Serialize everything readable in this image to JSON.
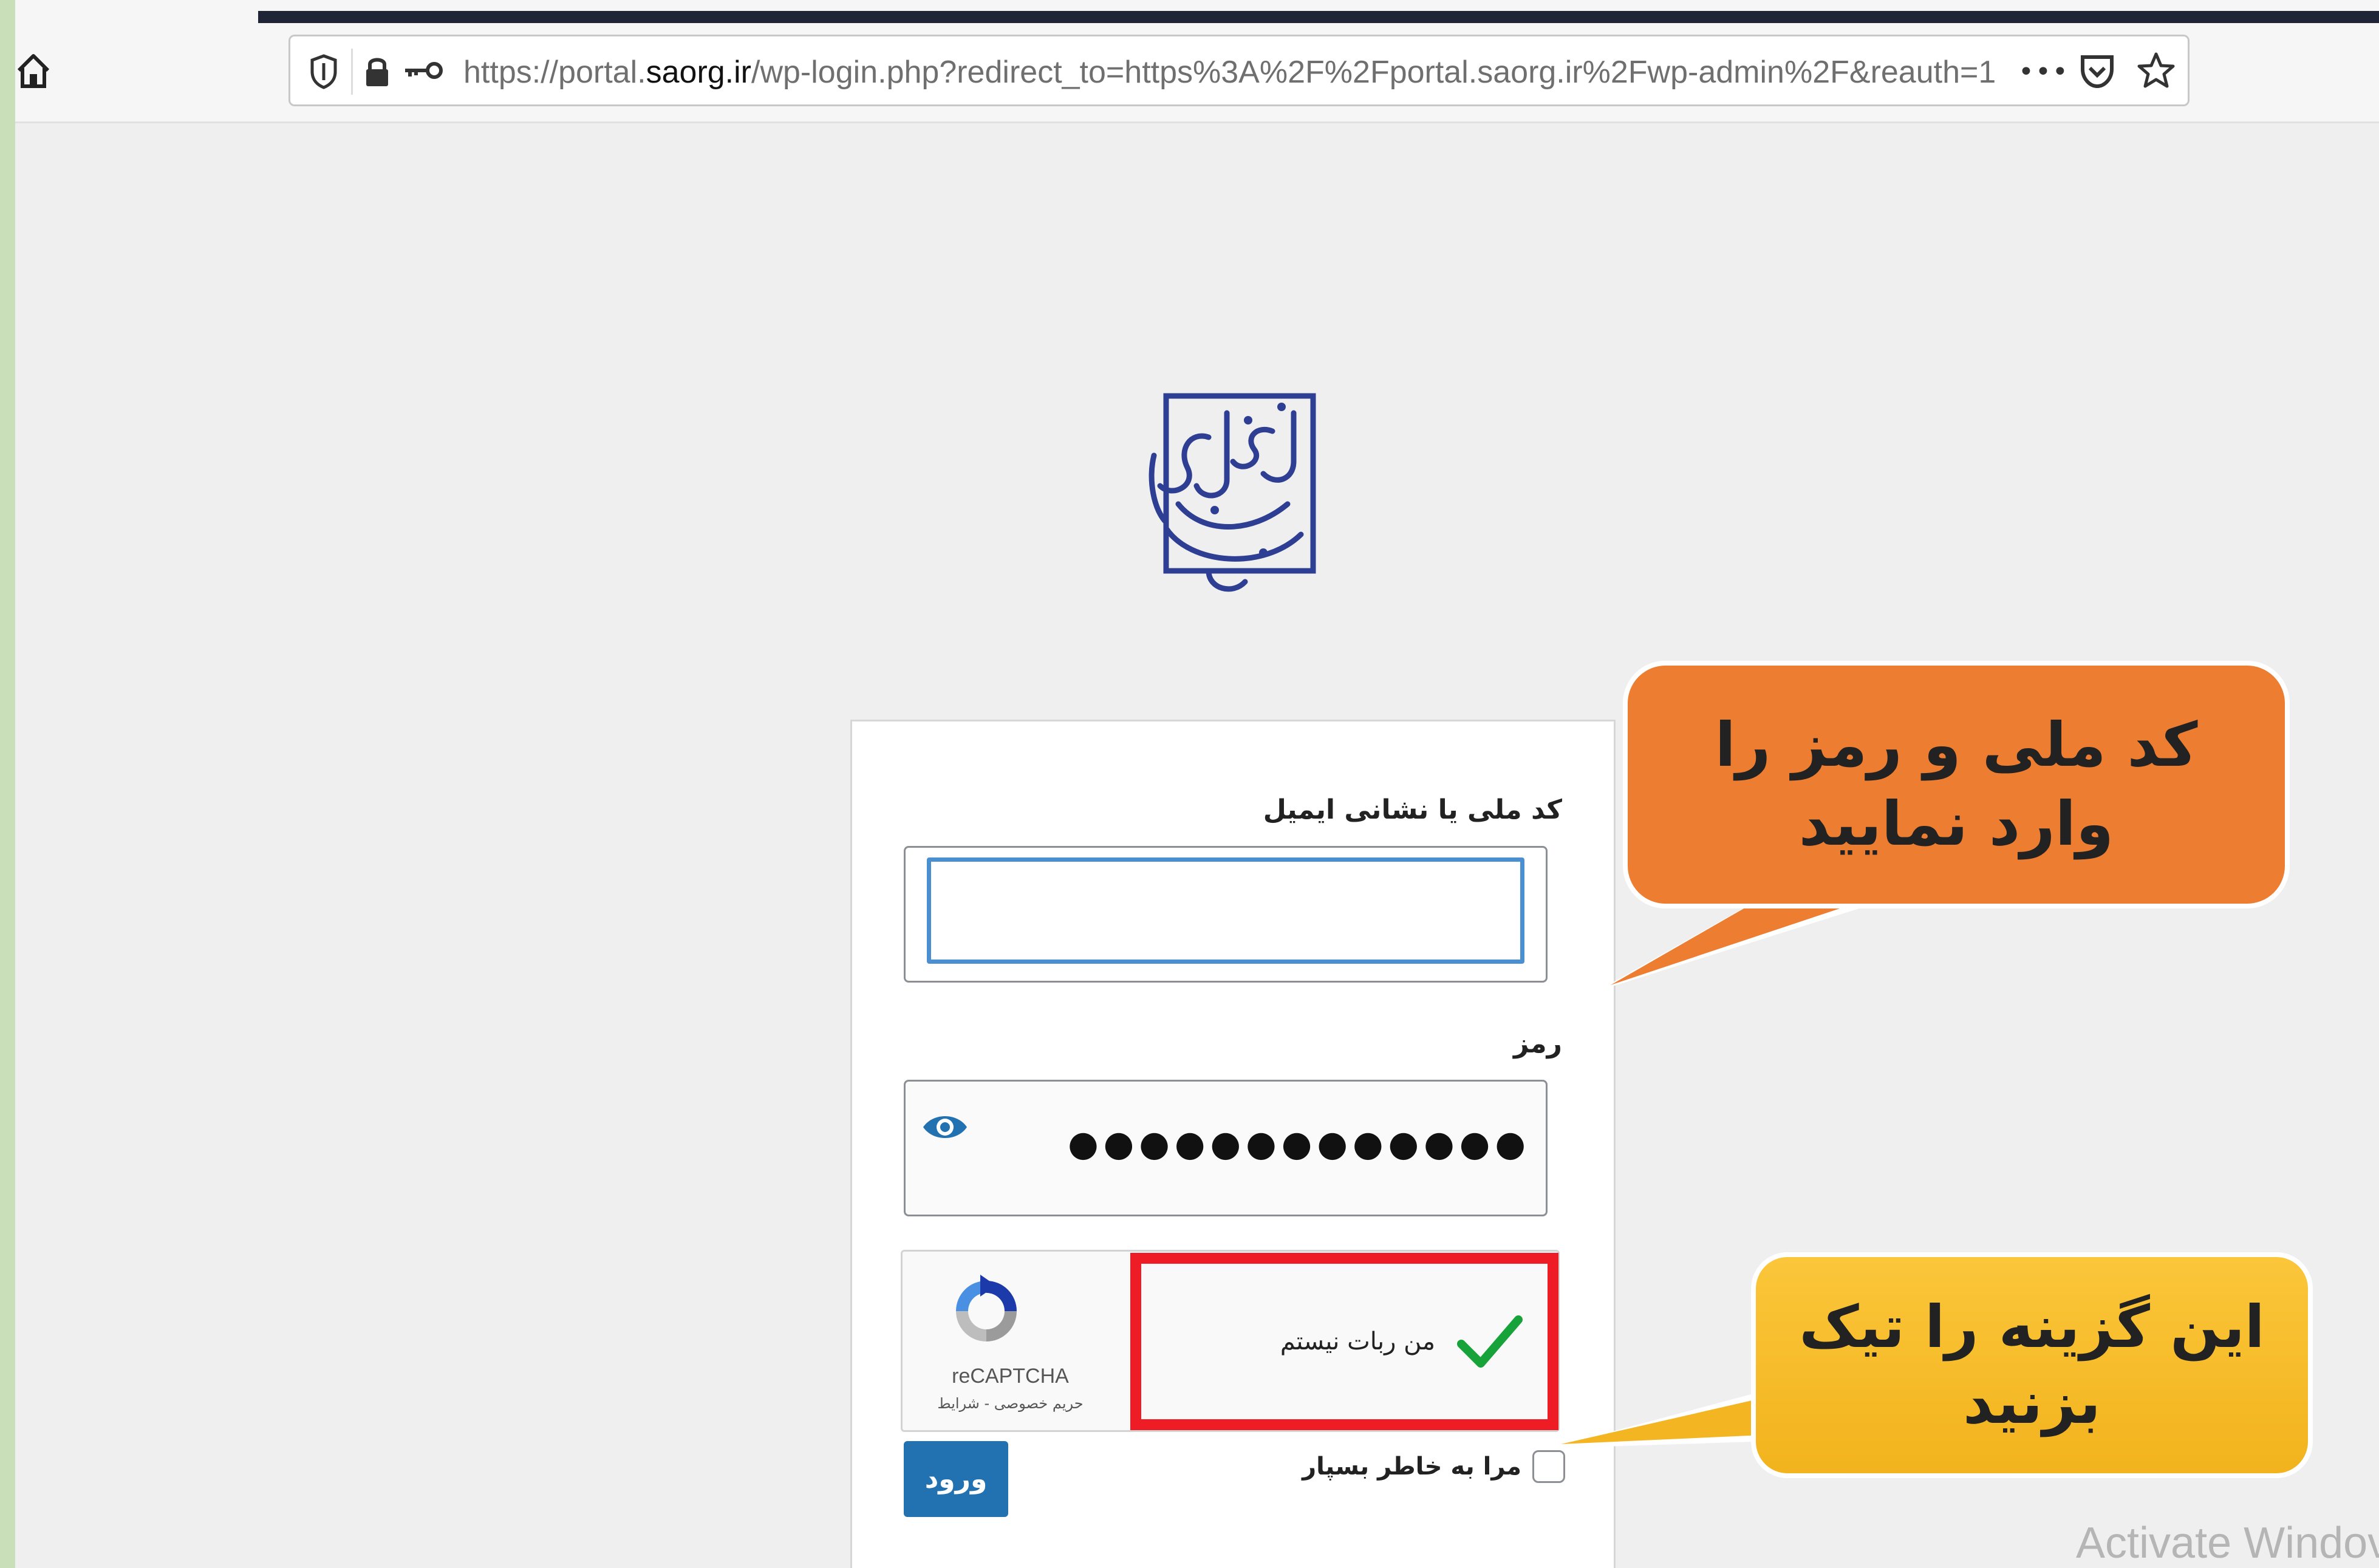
{
  "browser": {
    "url_prefix": "https://portal.",
    "url_domain": "saorg.ir",
    "url_suffix": "/wp-login.php?redirect_to=https%3A%2F%2Fportal.saorg.ir%2Fwp-admin%2F&reauth=1",
    "overflow_menu": "•••",
    "icons": [
      "home-icon",
      "shield-icon",
      "lock-icon",
      "key-icon",
      "pocket-icon",
      "star-icon"
    ]
  },
  "login": {
    "username_label": "کد ملی یا نشانی ایمیل",
    "username_value": "",
    "password_label": "رمز",
    "password_mask": "●●●●●●●●●●●●●",
    "recaptcha_label": "من ربات نیستم",
    "recaptcha_brand": "reCAPTCHA",
    "recaptcha_links": "حریم خصوصی - شرایط",
    "recaptcha_checked": true,
    "remember_label": "مرا به خاطر بسپار",
    "remember_checked": false,
    "submit_label": "ورود"
  },
  "annotations": {
    "callout_credentials_line1": "کد ملی و رمز را",
    "callout_credentials_line2": "وارد نمایید",
    "callout_checkbox_line1": "این گزینه را تیک",
    "callout_checkbox_line2": "بزنید"
  },
  "watermark": "Activate Windov",
  "colors": {
    "primary_button": "#2271b1",
    "callout_orange": "#ed7d31",
    "callout_yellow": "#f5b922",
    "highlight_red": "#ee1c24",
    "logo_blue": "#2e3f93",
    "check_green": "#18a23a"
  }
}
